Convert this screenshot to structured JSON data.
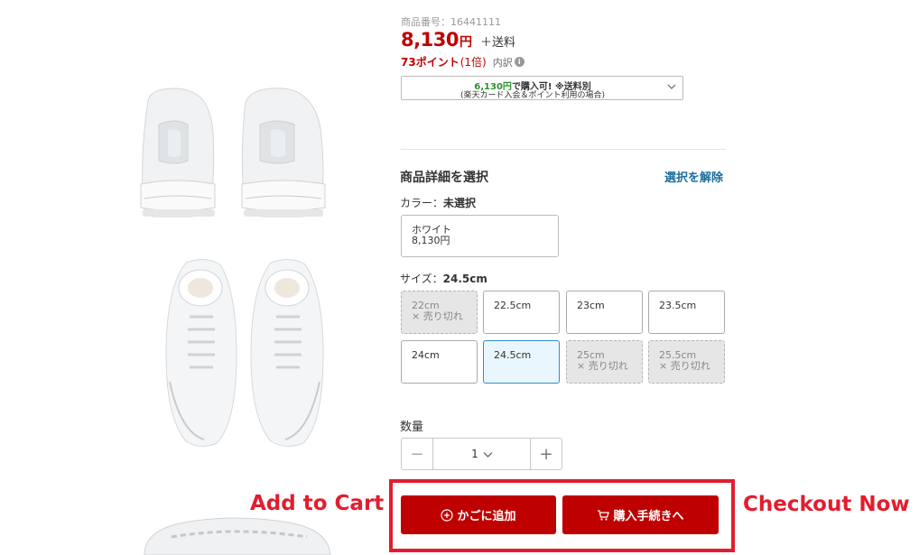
{
  "product": {
    "code": "商品番号：16441111",
    "price": "8,130",
    "currency": "円",
    "shipping": "＋送料",
    "points": "73ポイント",
    "points_multiplier": "(1倍)",
    "points_detail": "内訳",
    "info_icon": "i"
  },
  "card_promo": {
    "amount": "6,130円",
    "line1_rest": "で購入可! ※送料別",
    "line2": "(楽天カード入会＆ポイント利用の場合)"
  },
  "selection": {
    "title": "商品詳細を選択",
    "clear_label": "選択を解除",
    "color_label": "カラー：",
    "color_state": "未選択",
    "color_option": {
      "name": "ホワイト",
      "price": "8,130円"
    },
    "size_label": "サイズ：",
    "size_selected": "24.5cm",
    "sizes": [
      {
        "label": "22cm",
        "sub": "× 売り切れ",
        "state": "soldout"
      },
      {
        "label": "22.5cm",
        "sub": "",
        "state": "available"
      },
      {
        "label": "23cm",
        "sub": "",
        "state": "available"
      },
      {
        "label": "23.5cm",
        "sub": "",
        "state": "available"
      },
      {
        "label": "24cm",
        "sub": "",
        "state": "available"
      },
      {
        "label": "24.5cm",
        "sub": "",
        "state": "selected"
      },
      {
        "label": "25cm",
        "sub": "× 売り切れ",
        "state": "soldout"
      },
      {
        "label": "25.5cm",
        "sub": "× 売り切れ",
        "state": "soldout"
      }
    ]
  },
  "quantity": {
    "label": "数量",
    "value": "1",
    "minus": "−",
    "plus": "+"
  },
  "actions": {
    "add_to_cart": "かごに追加",
    "checkout": "購入手続きへ"
  },
  "annotations": {
    "cart": "Add to Cart",
    "checkout": "Checkout Now"
  },
  "colors": {
    "brand_red": "#bf0000",
    "annotation_red": "#e21d2f",
    "link_blue": "#1a6e9c",
    "selected_bg": "#eaf6fd",
    "selected_border": "#2f8fc9"
  },
  "icons": [
    "plus-circle-icon",
    "cart-icon",
    "chevron-down-icon",
    "info-icon"
  ]
}
